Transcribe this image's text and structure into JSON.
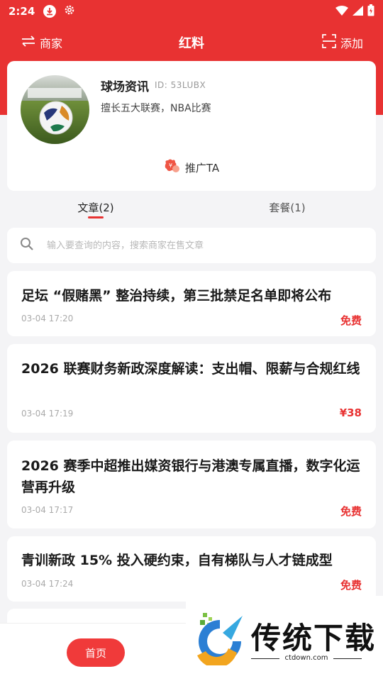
{
  "status_bar": {
    "time": "2:24"
  },
  "header": {
    "left_label": "商家",
    "title": "红料",
    "right_label": "添加"
  },
  "profile": {
    "name": "球场资讯",
    "id_text": "ID: 53LUBX",
    "description": "擅长五大联赛，NBA比赛",
    "promote_label": "推广TA"
  },
  "tabs": [
    {
      "label": "文章(2)",
      "active": true
    },
    {
      "label": "套餐(1)",
      "active": false
    }
  ],
  "search": {
    "placeholder": "输入要查询的内容，搜索商家在售文章",
    "value": ""
  },
  "articles": [
    {
      "title": "足坛 “假赌黑” 整治持续，第三批禁足名单即将公布",
      "time": "03-04 17:20",
      "price": "免费"
    },
    {
      "title": "2026 联赛财务新政深度解读：支出帽、限薪与合规红线",
      "time": "03-04 17:19",
      "price": "¥38"
    },
    {
      "title": "2026 赛季中超推出媒资银行与港澳专属直播，数字化运营再升级",
      "time": "03-04 17:17",
      "price": "免费"
    },
    {
      "title": "青训新政 15% 投入硬约束，自有梯队与人才链成型",
      "time": "03-04 17:24",
      "price": "免费"
    }
  ],
  "bottom_nav": {
    "home_label": "首页"
  },
  "watermark": {
    "text": "传统下载",
    "url": "ctdown.com"
  },
  "colors": {
    "primary": "#e83232",
    "background": "#f4f4f6",
    "card": "#ffffff"
  }
}
